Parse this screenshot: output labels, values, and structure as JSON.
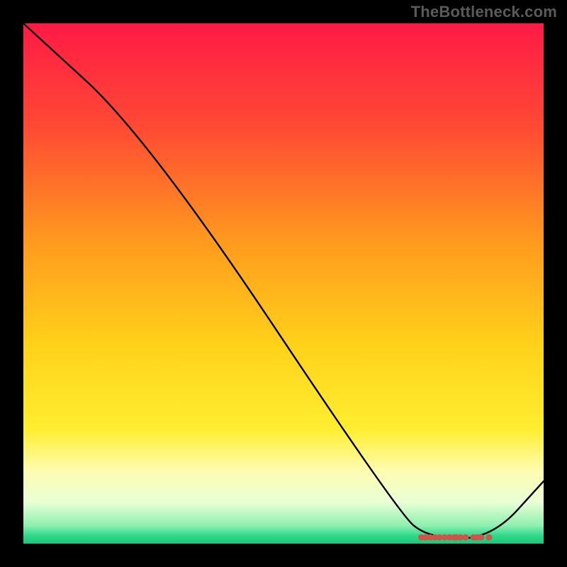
{
  "watermark": "TheBottleneck.com",
  "chart_data": {
    "type": "line",
    "title": "",
    "xlabel": "",
    "ylabel": "",
    "xlim": [
      0,
      100
    ],
    "ylim": [
      0,
      100
    ],
    "grid": false,
    "legend": false,
    "background_gradient": [
      {
        "offset": 0.0,
        "color": "#ff1a45"
      },
      {
        "offset": 0.2,
        "color": "#ff4a34"
      },
      {
        "offset": 0.42,
        "color": "#ff9a1e"
      },
      {
        "offset": 0.62,
        "color": "#ffd21a"
      },
      {
        "offset": 0.78,
        "color": "#ffee30"
      },
      {
        "offset": 0.86,
        "color": "#fffcb0"
      },
      {
        "offset": 0.92,
        "color": "#e9ffd6"
      },
      {
        "offset": 0.965,
        "color": "#8ff0b0"
      },
      {
        "offset": 0.985,
        "color": "#2fd88a"
      },
      {
        "offset": 1.0,
        "color": "#17c97a"
      }
    ],
    "series": [
      {
        "name": "bottleneck-curve",
        "color": "#000000",
        "points": [
          {
            "x": 0,
            "y": 100
          },
          {
            "x": 24,
            "y": 78
          },
          {
            "x": 72,
            "y": 6
          },
          {
            "x": 78,
            "y": 1
          },
          {
            "x": 90,
            "y": 1
          },
          {
            "x": 100,
            "y": 12
          }
        ]
      }
    ],
    "markers": {
      "name": "optimal-range-dots",
      "color": "#d0544a",
      "y": 1.2,
      "xs": [
        76.5,
        77.3,
        78.2,
        79.1,
        80.0,
        81.0,
        81.9,
        82.8,
        83.2,
        84.0,
        85.0,
        86.5,
        87.2,
        88.0,
        89.5
      ]
    }
  }
}
